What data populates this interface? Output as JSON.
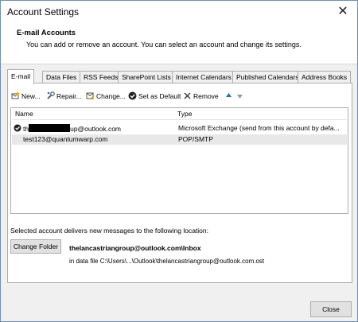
{
  "window": {
    "title": "Account Settings",
    "close_glyph": "✕"
  },
  "header": {
    "title": "E-mail Accounts",
    "description": "You can add or remove an account. You can select an account and change its settings."
  },
  "tabs": [
    {
      "label": "E-mail",
      "active": true
    },
    {
      "label": "Data Files"
    },
    {
      "label": "RSS Feeds"
    },
    {
      "label": "SharePoint Lists"
    },
    {
      "label": "Internet Calendars"
    },
    {
      "label": "Published Calendars"
    },
    {
      "label": "Address Books"
    }
  ],
  "toolbar": {
    "new_label": "New...",
    "repair_label": "Repair...",
    "change_label": "Change...",
    "default_label": "Set as Default",
    "remove_label": "Remove"
  },
  "list": {
    "col_name": "Name",
    "col_type": "Type",
    "rows": [
      {
        "name_prefix": "th",
        "name_suffix": "up@outlook.com",
        "type": "Microsoft Exchange (send from this account by defa..."
      },
      {
        "name": "test123@quantumwarp.com",
        "type": "POP/SMTP"
      }
    ]
  },
  "delivery": {
    "message": "Selected account delivers new messages to the following location:",
    "change_folder_label": "Change Folder",
    "location": "thelancastriangroup@outlook.com\\Inbox",
    "data_file": "in data file C:\\Users\\...\\Outlook\\thelancastriangroup@outlook.com.ost"
  },
  "footer": {
    "close_label": "Close"
  },
  "colors": {
    "accent_blue": "#1e73be",
    "remove_red": "#c42b1c",
    "border": "#adadad"
  }
}
